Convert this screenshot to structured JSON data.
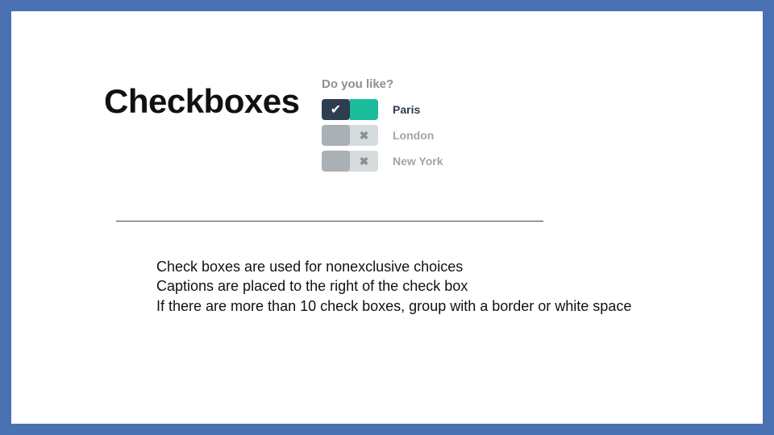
{
  "title": "Checkboxes",
  "example": {
    "question": "Do you like?",
    "options": [
      {
        "label": "Paris",
        "checked": true
      },
      {
        "label": "London",
        "checked": false
      },
      {
        "label": "New York",
        "checked": false
      }
    ]
  },
  "icons": {
    "check": "✔",
    "cross": "✖"
  },
  "body": {
    "line1": "Check boxes are used for nonexclusive choices",
    "line2": "Captions are placed to the right of the check box",
    "line3": "If there are more than 10 check boxes, group with a border or white space"
  }
}
